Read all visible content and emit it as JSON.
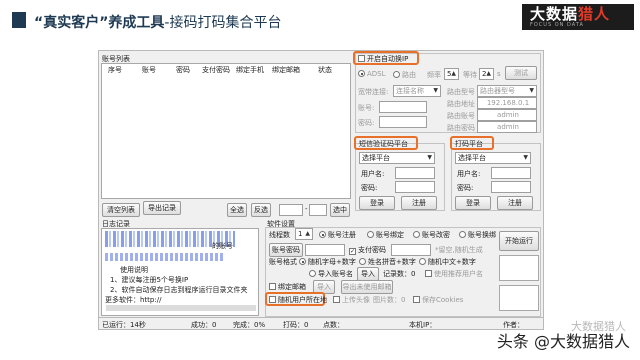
{
  "slide": {
    "title_bold": "“真实客户”养成工具",
    "title_rest": "-接码打码集合平台",
    "logo_big_a": "大数据",
    "logo_big_b": "猎人",
    "logo_small": "FOCUS ON DATA",
    "watermark": "头条 @大数据猎人",
    "watermark_faint": "大数据猎人"
  },
  "account_list": {
    "title": "账号列表",
    "columns": [
      "序号",
      "账号",
      "密码",
      "支付密码",
      "绑定手机",
      "绑定邮箱",
      "状态"
    ],
    "clear_button": "清空列表",
    "export_button": "导出记录",
    "select_all": "全选",
    "invert": "反选",
    "range_sep": "-",
    "select_in": "选中"
  },
  "ip": {
    "auto_switch": "开启自动换IP",
    "adsl": "ADSL",
    "router": "路由",
    "freq_label": "频率",
    "freq_value": "5",
    "wait_label": "等待",
    "wait_value": "2",
    "wait_unit": "s",
    "test_button": "测试",
    "broadband_label": "宽带连接:",
    "broadband_value": "连接名称",
    "router_model_label": "路由型号",
    "router_model_value": "路由器型号",
    "account_label": "账号:",
    "password_label": "密码:",
    "router_ip_label": "路由地址",
    "router_ip": "192.168.0.1",
    "router_account_label": "路由账号",
    "router_account": "admin",
    "router_password_label": "路由密码",
    "router_password": "admin"
  },
  "sms": {
    "title": "短信验证码平台",
    "select": "选择平台",
    "user_label": "用户名:",
    "password_label": "密码:",
    "login": "登录",
    "register": "注册"
  },
  "captcha": {
    "title": "打码平台",
    "select": "选择平台",
    "user_label": "用户名:",
    "password_label": "密码:",
    "login": "登录",
    "register": "注册"
  },
  "log": {
    "title": "日志记录",
    "lines": [
      "的账号",
      "使用说明",
      "1、建议每注册5个号换IP",
      "2、软件自动保存日志到程序运行目录文件夹",
      "更多软件：http://"
    ]
  },
  "settings": {
    "title": "软件设置",
    "threads_label": "线程数",
    "threads_value": "1",
    "mode_register": "账号注册",
    "mode_bind": "账号绑定",
    "mode_change": "账号改密",
    "mode_unbind": "账号换绑",
    "acct_pwd_label": "账号密码",
    "pay_pwd_label": "支付密码",
    "pay_pwd_hint": "*留空,随机生成",
    "format_label": "账号格式",
    "fmt_random": "随机字母+数字",
    "fmt_pinyin": "姓名拼音+数字",
    "fmt_cn": "随机中文+数字",
    "fmt_import": "导入账号名",
    "import_button": "导入",
    "record_count_label": "记录数：0",
    "used_tip": "使用推荐用户名",
    "bind_email": "绑定邮箱",
    "import_email": "导入",
    "not_imported": "导出未使用邮箱",
    "random_location": "随机用户所在地",
    "upload_avatar": "上传头像",
    "image_count_label": "图片数：0",
    "save_cookies": "保存Cookies",
    "start_button": "开始运行"
  },
  "status": {
    "run_time": "已运行：14秒",
    "success": "成功：0",
    "complete": "完成：0%",
    "captcha": "打码：0",
    "points": "点数：",
    "local_ip": "本机IP：",
    "author": "作者："
  }
}
